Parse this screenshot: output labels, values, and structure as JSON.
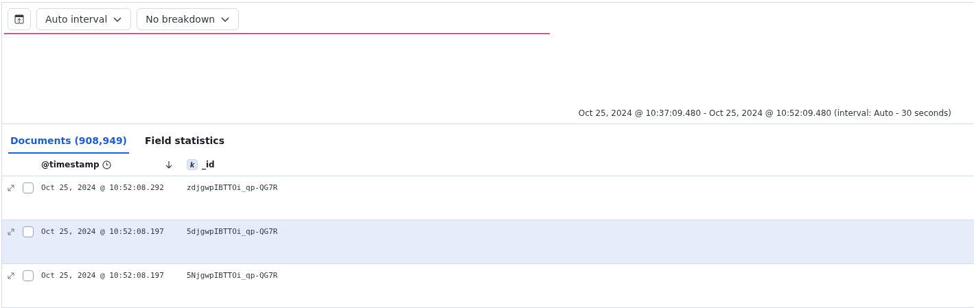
{
  "toolbar": {
    "buttons": [
      {
        "kind": "icon"
      },
      {
        "kind": "dropdown",
        "label": "Auto interval"
      },
      {
        "kind": "dropdown",
        "label": "No breakdown"
      }
    ]
  },
  "chart": {
    "time_range": "Oct 25, 2024 @ 10:37:09.480 - Oct 25, 2024 @ 10:52:09.480 (interval: Auto - 30 seconds)"
  },
  "tabs": [
    {
      "label": "Documents (908,949)",
      "selected": true
    },
    {
      "label": "Field statistics",
      "selected": false
    }
  ],
  "table": {
    "columns": [
      {
        "label": "@timestamp",
        "kind": "time"
      },
      {
        "label": "_id",
        "kind": "keyword",
        "type_badge": "k"
      }
    ],
    "rows": [
      {
        "timestamp": "Oct 25, 2024 @ 10:52:08.292",
        "id": "zdjgwpIBTTOi_qp-QG7R",
        "checked": false,
        "highlighted": false
      },
      {
        "timestamp": "Oct 25, 2024 @ 10:52:08.197",
        "id": "5djgwpIBTTOi_qp-QG7R",
        "checked": false,
        "highlighted": true
      },
      {
        "timestamp": "Oct 25, 2024 @ 10:52:08.197",
        "id": "5NjgwpIBTTOi_qp-QG7R",
        "checked": false,
        "highlighted": false
      }
    ]
  }
}
